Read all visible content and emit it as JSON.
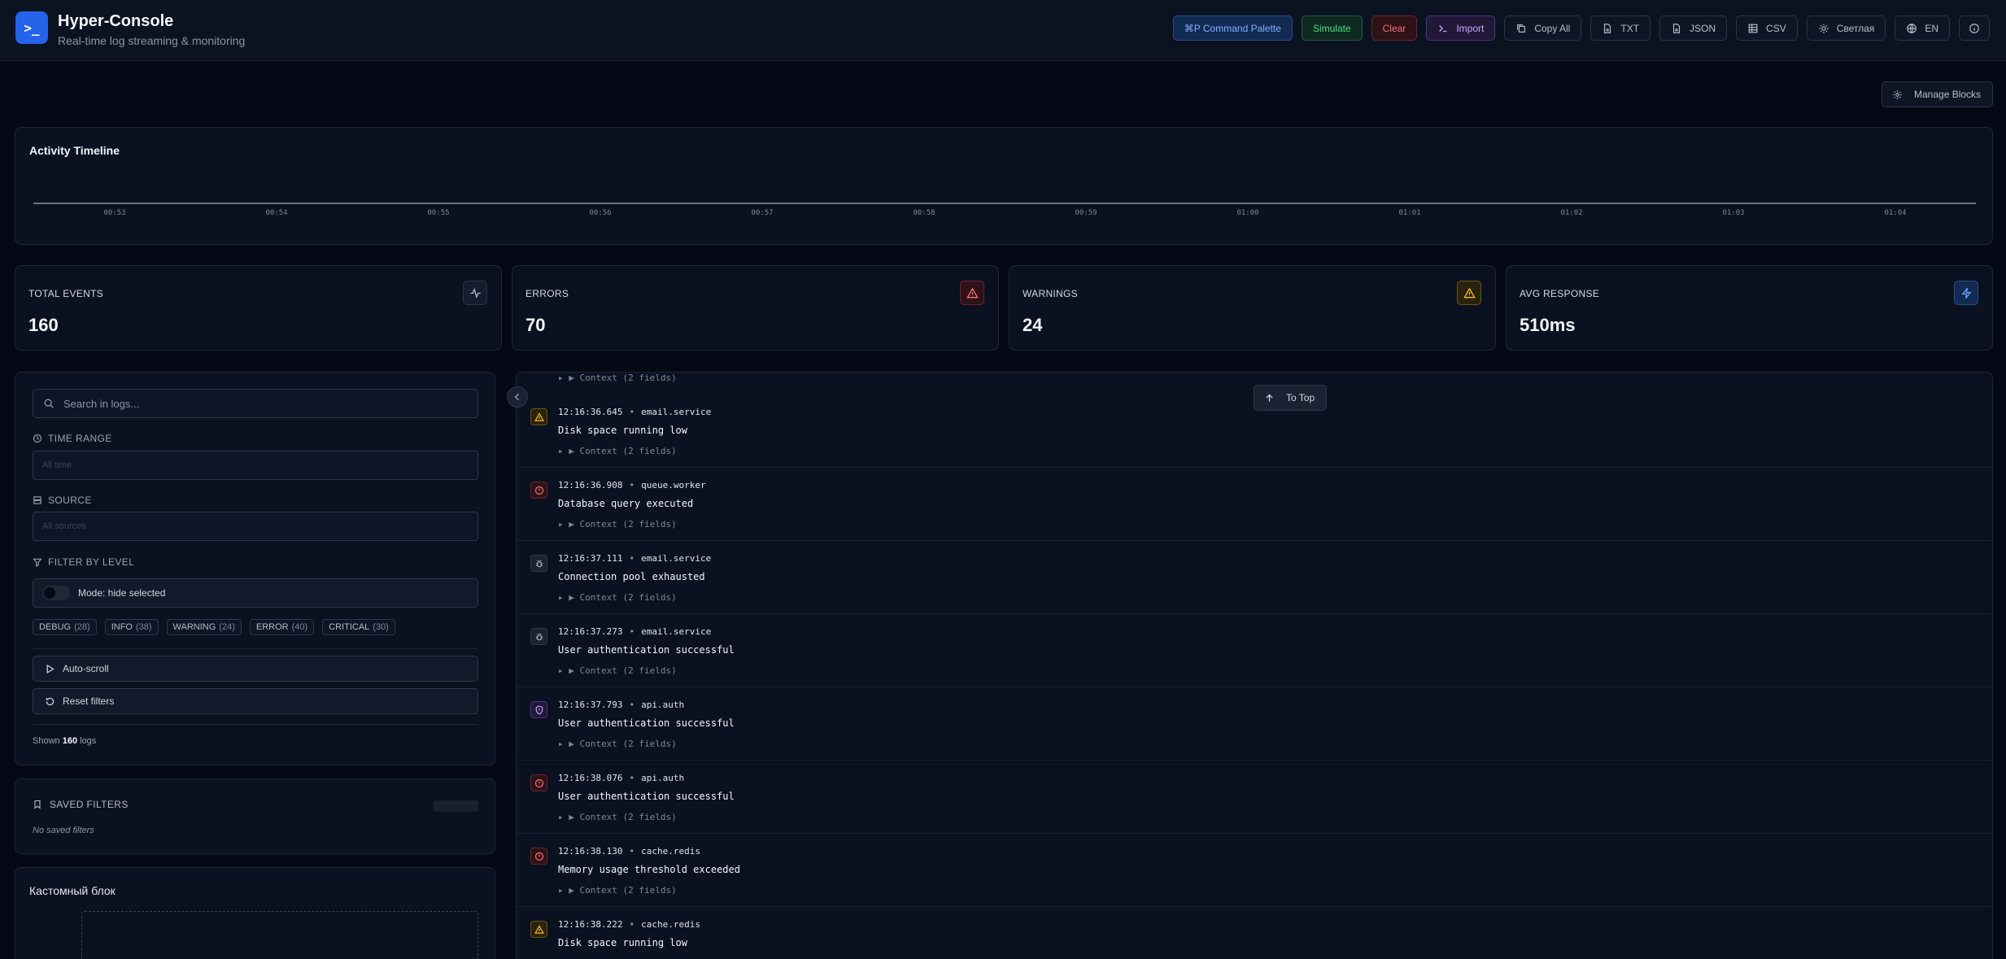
{
  "header": {
    "logo_glyph": ">_",
    "title": "Hyper-Console",
    "subtitle": "Real-time log streaming & monitoring",
    "buttons": {
      "palette": "⌘P Command Palette",
      "simulate": "Simulate",
      "clear": "Clear",
      "import": "Import",
      "copy_all": "Copy All",
      "txt": "TXT",
      "json": "JSON",
      "csv": "CSV",
      "theme": "Светлая",
      "lang": "EN"
    }
  },
  "manage_blocks": "Manage Blocks",
  "timeline": {
    "title": "Activity Timeline",
    "ticks": [
      "00:53",
      "00:54",
      "00:55",
      "00:56",
      "00:57",
      "00:58",
      "00:59",
      "01:00",
      "01:01",
      "01:02",
      "01:03",
      "01:04"
    ]
  },
  "stats": [
    {
      "label": "TOTAL EVENTS",
      "value": "160",
      "icon": "activity-icon"
    },
    {
      "label": "ERRORS",
      "value": "70",
      "icon": "alert-triangle-icon",
      "color": "#f87171"
    },
    {
      "label": "WARNINGS",
      "value": "24",
      "icon": "warning-icon",
      "color": "#fbbf24"
    },
    {
      "label": "AVG RESPONSE",
      "value": "510ms",
      "icon": "zap-icon",
      "color": "#60a5fa"
    }
  ],
  "filters": {
    "search_placeholder": "Search in logs...",
    "time_range_label": "TIME RANGE",
    "time_range_placeholder": "All time",
    "source_label": "SOURCE",
    "source_placeholder": "All sources",
    "level_label": "FILTER BY LEVEL",
    "mode_label": "Mode: hide selected",
    "levels": [
      {
        "name": "DEBUG",
        "count": "(28)"
      },
      {
        "name": "INFO",
        "count": "(38)"
      },
      {
        "name": "WARNING",
        "count": "(24)"
      },
      {
        "name": "ERROR",
        "count": "(40)"
      },
      {
        "name": "CRITICAL",
        "count": "(30)"
      }
    ],
    "autoscroll": "Auto-scroll",
    "reset": "Reset filters",
    "shown_prefix": "Shown",
    "shown_count": "160",
    "shown_suffix": "logs"
  },
  "saved_filters": {
    "title": "SAVED FILTERS",
    "empty": "No saved filters"
  },
  "custom_block": {
    "title": "Кастомный блок"
  },
  "logs": {
    "to_top": "To Top",
    "context_label": "▸ ▶ Context (2 fields)",
    "entries": [
      {
        "level": "warning",
        "time": "12:16:36.645",
        "source": "email.service",
        "message": "Disk space running low"
      },
      {
        "level": "error",
        "time": "12:16:36.908",
        "source": "queue.worker",
        "message": "Database query executed"
      },
      {
        "level": "debug",
        "time": "12:16:37.111",
        "source": "email.service",
        "message": "Connection pool exhausted"
      },
      {
        "level": "debug",
        "time": "12:16:37.273",
        "source": "email.service",
        "message": "User authentication successful"
      },
      {
        "level": "critical",
        "time": "12:16:37.793",
        "source": "api.auth",
        "message": "User authentication successful"
      },
      {
        "level": "error",
        "time": "12:16:38.076",
        "source": "api.auth",
        "message": "User authentication successful"
      },
      {
        "level": "error",
        "time": "12:16:38.130",
        "source": "cache.redis",
        "message": "Memory usage threshold exceeded"
      },
      {
        "level": "warning",
        "time": "12:16:38.222",
        "source": "cache.redis",
        "message": "Disk space running low"
      }
    ]
  }
}
